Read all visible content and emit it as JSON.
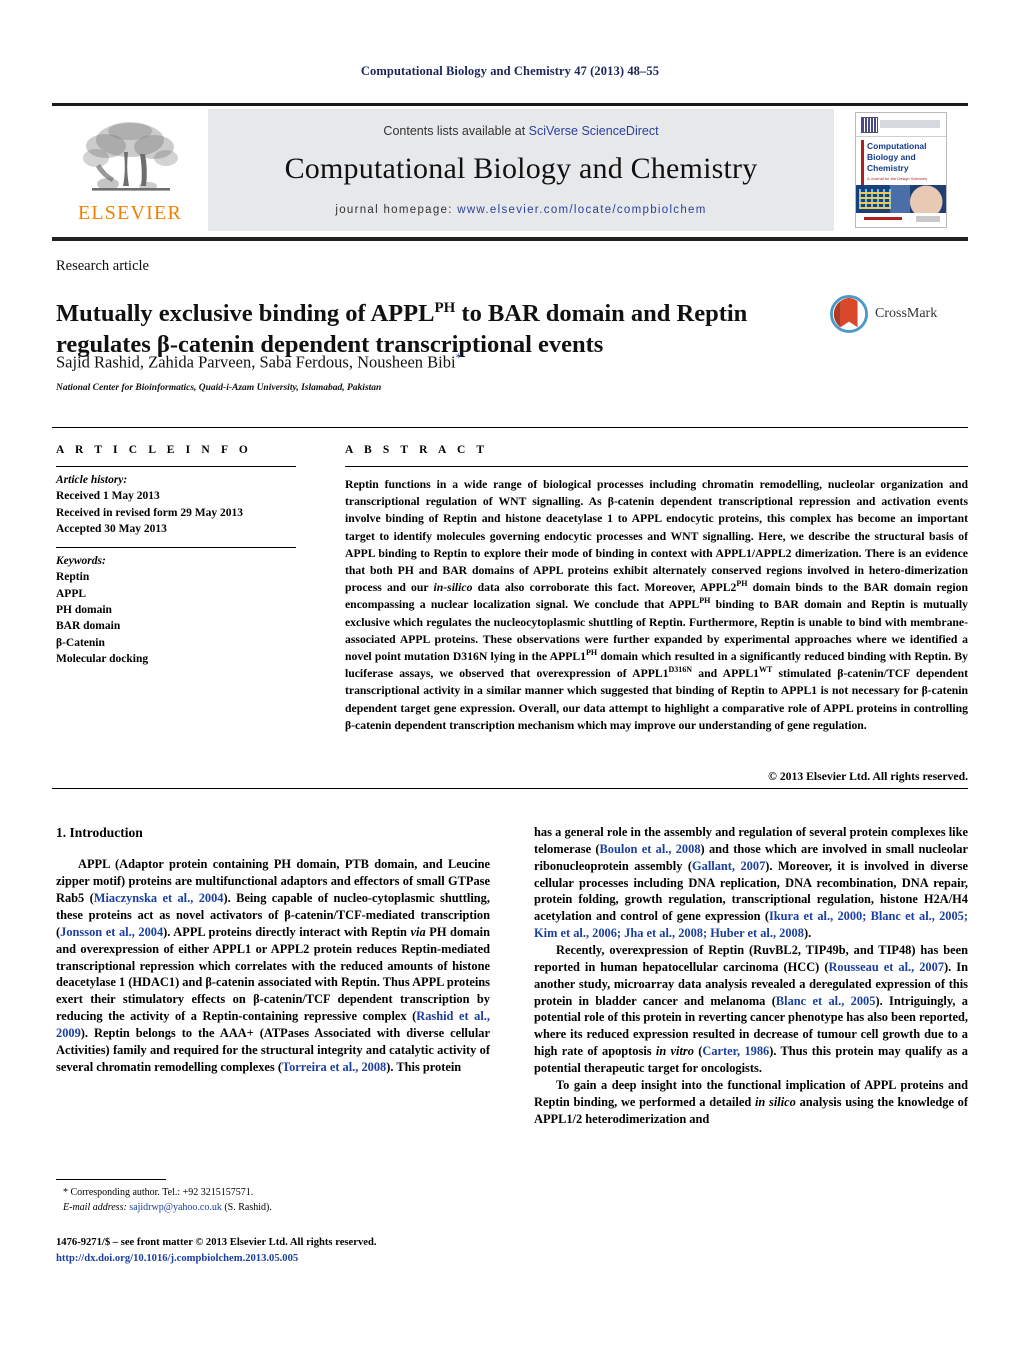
{
  "running_head": "Computational Biology and Chemistry 47 (2013) 48–55",
  "masthead": {
    "contents_prefix": "Contents lists available at ",
    "sciencedirect": "SciVerse ScienceDirect",
    "journal_title": "Computational Biology and Chemistry",
    "homepage_prefix": "journal homepage: ",
    "homepage_url": "www.elsevier.com/locate/compbiolchem",
    "publisher": "ELSEVIER",
    "cover": {
      "line1": "Computational",
      "line2": "Biology and",
      "line3": "Chemistry",
      "subtitle": "A Journal for the Design Sciences"
    }
  },
  "article": {
    "type": "Research article",
    "title_part1": "Mutually exclusive binding of APPL",
    "title_sup1": "PH",
    "title_part2": " to BAR domain and Reptin regulates β-catenin dependent transcriptional events",
    "authors": "Sajid Rashid, Zahida Parveen, Saba Ferdous, Nousheen Bibi",
    "author_marker": "*",
    "affiliation": "National Center for Bioinformatics, Quaid-i-Azam University, Islamabad, Pakistan",
    "crossmark_label": "CrossMark"
  },
  "article_info": {
    "label": "A R T I C L E   I N F O",
    "history_heading": "Article history:",
    "history": [
      "Received 1 May 2013",
      "Received in revised form 29 May 2013",
      "Accepted 30 May 2013"
    ],
    "keywords_heading": "Keywords:",
    "keywords": [
      "Reptin",
      "APPL",
      "PH domain",
      "BAR domain",
      "β-Catenin",
      "Molecular docking"
    ]
  },
  "abstract": {
    "label": "A B S T R A C T",
    "paragraph_1": "Reptin functions in a wide range of biological processes including chromatin remodelling, nucleolar organization and transcriptional regulation of WNT signalling. As β-catenin dependent transcriptional repression and activation events involve binding of Reptin and histone deacetylase 1 to APPL endocytic proteins, this complex has become an important target to identify molecules governing endocytic processes and WNT signalling. Here, we describe the structural basis of APPL binding to Reptin to explore their mode of binding in context with APPL1/APPL2 dimerization. There is an evidence that both PH and BAR domains of APPL proteins exhibit alternately conserved regions involved in hetero-dimerization process and our ",
    "italic_1": "in-silico",
    "paragraph_2": " data also corroborate this fact. Moreover, APPL2",
    "sup_1": "PH",
    "paragraph_3": " domain binds to the BAR domain region encompassing a nuclear localization signal. We conclude that APPL",
    "sup_2": "PH",
    "paragraph_4": " binding to BAR domain and Reptin is mutually exclusive which regulates the nucleocytoplasmic shuttling of Reptin. Furthermore, Reptin is unable to bind with membrane-associated APPL proteins. These observations were further expanded by experimental approaches where we identified a novel point mutation D316N lying in the APPL1",
    "sup_3": "PH",
    "paragraph_5": " domain which resulted in a significantly reduced binding with Reptin. By luciferase assays, we observed that overexpression of APPL1",
    "sup_4": "D316N",
    "paragraph_6": " and APPL1",
    "sup_5": "WT",
    "paragraph_7": " stimulated β-catenin/TCF dependent transcriptional activity in a similar manner which suggested that binding of Reptin to APPL1 is not necessary for β-catenin dependent target gene expression. Overall, our data attempt to highlight a comparative role of APPL proteins in controlling β-catenin dependent transcription mechanism which may improve our understanding of gene regulation.",
    "copyright": "© 2013 Elsevier Ltd. All rights reserved."
  },
  "introduction": {
    "heading": "1.  Introduction",
    "left": {
      "p1_a": "APPL (Adaptor protein containing PH domain, PTB domain, and Leucine zipper motif) proteins are multifunctional adaptors and effectors of small GTPase Rab5 (",
      "ref1": "Miaczynska et al., 2004",
      "p1_b": "). Being capable of nucleo-cytoplasmic shuttling, these proteins act as novel activators of β-catenin/TCF-mediated transcription (",
      "ref2": "Jonsson et al., 2004",
      "p1_c": "). APPL proteins directly interact with Reptin ",
      "italic1": "via",
      "p1_d": " PH domain and overexpression of either APPL1 or APPL2 protein reduces Reptin-mediated transcriptional repression which correlates with the reduced amounts of histone deacetylase 1 (HDAC1) and β-catenin associated with Reptin. Thus APPL proteins exert their stimulatory effects on β-catenin/TCF dependent transcription by reducing the activity of a Reptin-containing repressive complex (",
      "ref3": "Rashid et al., 2009",
      "p1_e": "). Reptin belongs to the AAA+ (ATPases Associated with diverse cellular Activities) family and required for the structural integrity and catalytic activity of several chromatin remodelling complexes (",
      "ref4": "Torreira et al., 2008",
      "p1_f": "). This protein"
    },
    "right": {
      "p1_a": "has a general role in the assembly and regulation of several protein complexes like telomerase (",
      "ref1": "Boulon et al., 2008",
      "p1_b": ") and those which are involved in small nucleolar ribonucleoprotein assembly (",
      "ref2": "Gallant, 2007",
      "p1_c": "). Moreover, it is involved in diverse cellular processes including DNA replication, DNA recombination, DNA repair, protein folding, growth regulation, transcriptional regulation, histone H2A/H4 acetylation and control of gene expression (",
      "ref3": "Ikura et al., 2000; Blanc et al., 2005; Kim et al., 2006; Jha et al., 2008; Huber et al., 2008",
      "p1_d": ").",
      "p2_a": "Recently, overexpression of Reptin (RuvBL2, TIP49b, and TIP48) has been reported in human hepatocellular carcinoma (HCC) (",
      "ref4": "Rousseau et al., 2007",
      "p2_b": "). In another study, microarray data analysis revealed a deregulated expression of this protein in bladder cancer and melanoma (",
      "ref5": "Blanc et al., 2005",
      "p2_c": "). Intriguingly, a potential role of this protein in reverting cancer phenotype has also been reported, where its reduced expression resulted in decrease of tumour cell growth due to a high rate of apoptosis ",
      "italic1": "in vitro",
      "p2_d": " (",
      "ref6": "Carter, 1986",
      "p2_e": "). Thus this protein may qualify as a potential therapeutic target for oncologists.",
      "p3_a": "To gain a deep insight into the functional implication of APPL proteins and Reptin binding, we performed a detailed ",
      "italic2": "in silico",
      "p3_b": " analysis using the knowledge of APPL1/2 heterodimerization and"
    }
  },
  "footnote": {
    "corresponding": "* Corresponding author. Tel.: +92 3215157571.",
    "email_label": "E-mail address:",
    "email": "sajidrwp@yahoo.co.uk",
    "email_suffix": " (S. Rashid)."
  },
  "imprint": {
    "line1": "1476-9271/$ – see front matter © 2013 Elsevier Ltd. All rights reserved.",
    "doi": "http://dx.doi.org/10.1016/j.compbiolchem.2013.05.005"
  },
  "colors": {
    "link": "#1b3fa0",
    "elsevier_orange": "#F08000",
    "masthead_bg": "#e7e8ea",
    "running_head": "#1b2559"
  }
}
